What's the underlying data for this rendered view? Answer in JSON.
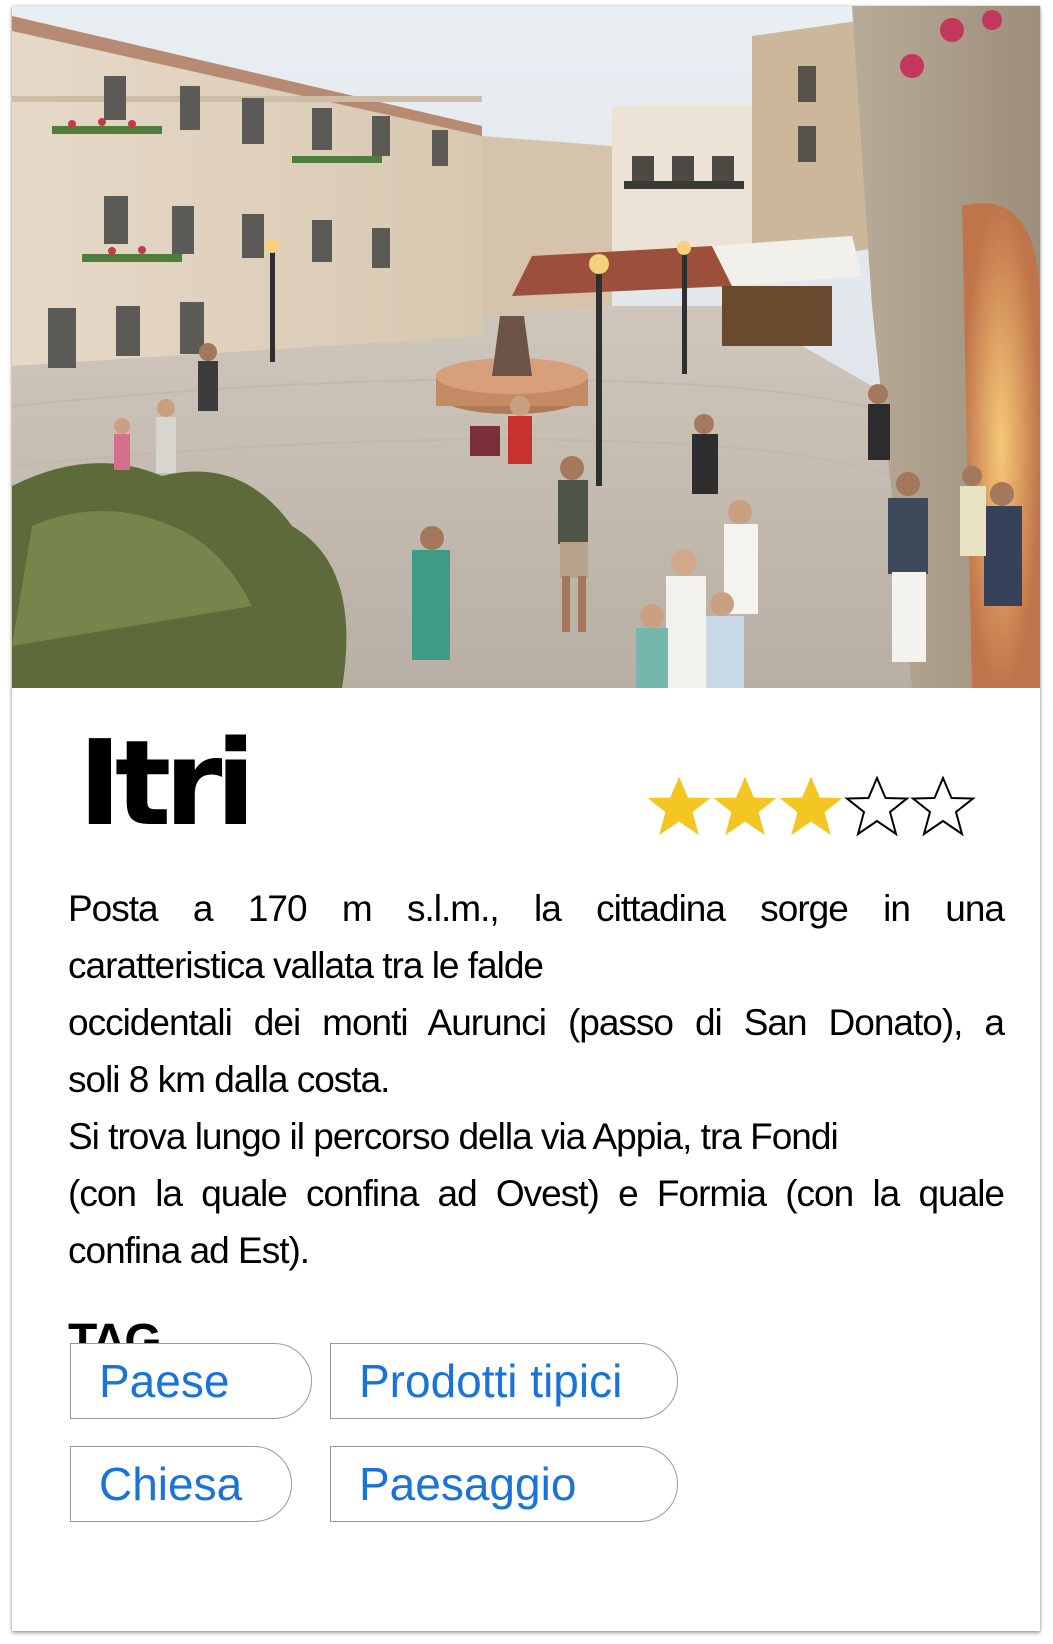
{
  "place": {
    "name": "Itri",
    "rating": 3,
    "rating_max": 5,
    "star_color": "#f3c623"
  },
  "description": {
    "lines": [
      "Posta a 170 m s.l.m., la cittadina sorge in una",
      "caratteristica vallata tra le falde",
      "occidentali dei monti Aurunci (passo di San Donato), a",
      "soli 8 km dalla costa.",
      "Si trova lungo il percorso della via Appia, tra Fondi",
      "(con la quale confina ad Ovest) e Formia (con la quale",
      "confina ad Est)."
    ]
  },
  "tags": {
    "heading": "TAG",
    "items": [
      {
        "label": "Paese"
      },
      {
        "label": "Prodotti tipici"
      },
      {
        "label": "Chiesa"
      },
      {
        "label": "Paesaggio"
      }
    ],
    "text_color": "#1a73d9"
  }
}
